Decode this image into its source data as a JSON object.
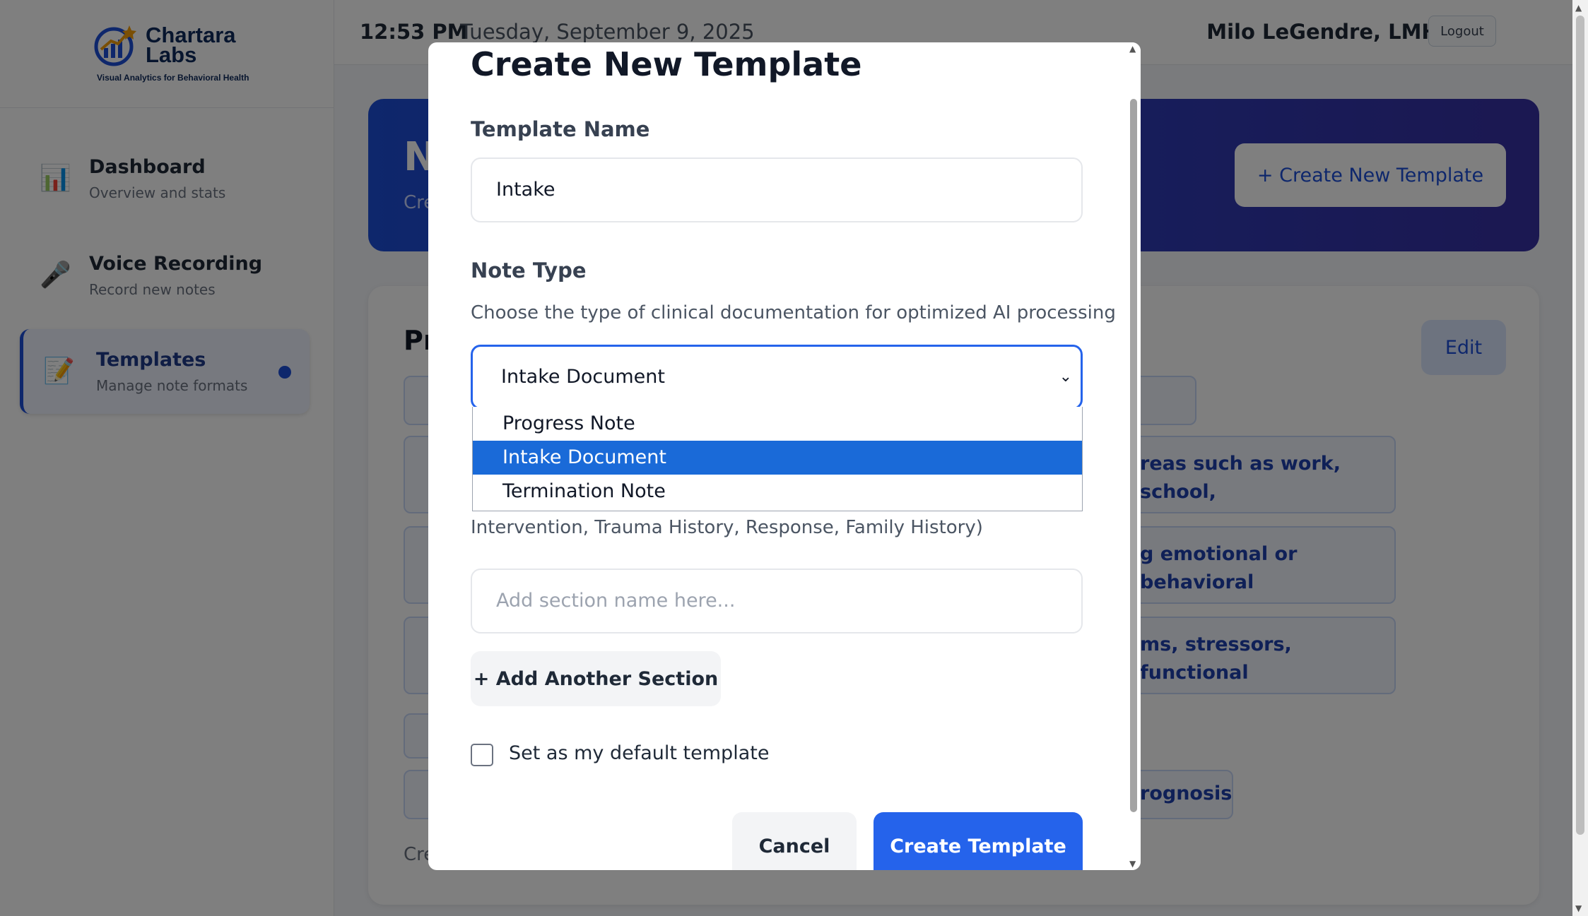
{
  "brand": {
    "name_line1": "Chartara",
    "name_line2": "Labs",
    "tagline": "Visual Analytics for Behavioral Health"
  },
  "sidebar": {
    "items": [
      {
        "title": "Dashboard",
        "subtitle": "Overview and stats",
        "icon": "bar-chart-icon"
      },
      {
        "title": "Voice Recording",
        "subtitle": "Record new notes",
        "icon": "microphone-icon"
      },
      {
        "title": "Templates",
        "subtitle": "Manage note formats",
        "icon": "memo-icon",
        "active": true
      }
    ]
  },
  "header": {
    "time": "12:53 PM",
    "date": "Tuesday, September 9, 2025",
    "user": "Milo LeGendre, LMHC",
    "logout_label": "Logout"
  },
  "hero": {
    "title_partial": "N",
    "subtitle_partial": "Cre",
    "create_button": "+ Create New Template"
  },
  "card": {
    "title_partial": "Pr",
    "edit_label": "Edit",
    "section_fragments": [
      "reas such as work, school,",
      "g emotional or behavioral",
      "ms, stressors, functional",
      "rognosis"
    ],
    "footer_partial": "Cre"
  },
  "modal": {
    "title": "Create New Template",
    "template_name_label": "Template Name",
    "template_name_value": "Intake",
    "note_type_label": "Note Type",
    "note_type_help": "Choose the type of clinical documentation for optimized AI processing",
    "note_type_selected": "Intake Document",
    "note_type_options": [
      "Progress Note",
      "Intake Document",
      "Termination Note"
    ],
    "sections_help_tail": "Intervention, Trauma History, Response, Family History)",
    "section_placeholder": "Add section name here...",
    "add_section_label": "+ Add Another Section",
    "default_checkbox_label": "Set as my default template",
    "cancel_label": "Cancel",
    "create_label": "Create Template"
  },
  "colors": {
    "accent": "#2563eb",
    "selected_option": "#1a6ad8",
    "brand_navy": "#0f2a5c"
  }
}
